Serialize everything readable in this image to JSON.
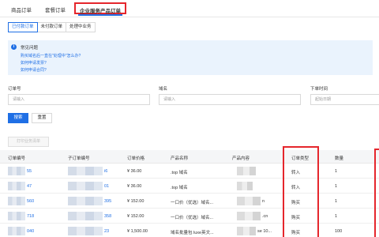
{
  "top_tabs": [
    "商品订单",
    "套餐订单",
    "企业服务产品订单"
  ],
  "status_tabs": [
    "已付款订单",
    "未付款订单",
    "处理中业务"
  ],
  "faq": {
    "title": "常见问题",
    "links": [
      "购买域名后一直在\"处理中\"怎么办?",
      "如何申请发票?",
      "如何申请合同?"
    ]
  },
  "filters": {
    "order_no_label": "订单号",
    "order_no_placeholder": "请输入",
    "domain_label": "域名",
    "domain_placeholder": "请输入",
    "time_label": "下单时间",
    "time_placeholder": "起始日期"
  },
  "buttons": {
    "search": "搜索",
    "reset": "重置",
    "print": "打印业务清单"
  },
  "table": {
    "headers": [
      "订单编号",
      "子订单编号",
      "订单价格",
      "产品名称",
      "产品内容",
      "订单类型",
      "数量"
    ],
    "rows": [
      {
        "order_tail": "55",
        "sub_tail": "i6",
        "price": "¥ 36.00",
        "product": ".top 域名",
        "content_tail": "",
        "type": "转入",
        "qty": "1"
      },
      {
        "order_tail": "47",
        "sub_tail": "01",
        "price": "¥ 36.00",
        "product": ".top 域名",
        "content_tail": "",
        "type": "转入",
        "qty": "1"
      },
      {
        "order_tail": "560",
        "sub_tail": "395",
        "price": "¥ 152.00",
        "product": "一口价（优选）域名...",
        "content_tail": "n",
        "type": "购买",
        "qty": "1"
      },
      {
        "order_tail": "718",
        "sub_tail": "358",
        "price": "¥ 152.00",
        "product": "一口价（优选）域名...",
        "content_tail": ".cn",
        "type": "购买",
        "qty": "1"
      },
      {
        "order_tail": "040",
        "sub_tail": "23",
        "price": "¥ 1,500.00",
        "product": "域名批量包 luxe英文...",
        "content_tail": "se 10...",
        "type": "购买",
        "qty": "100"
      }
    ]
  }
}
